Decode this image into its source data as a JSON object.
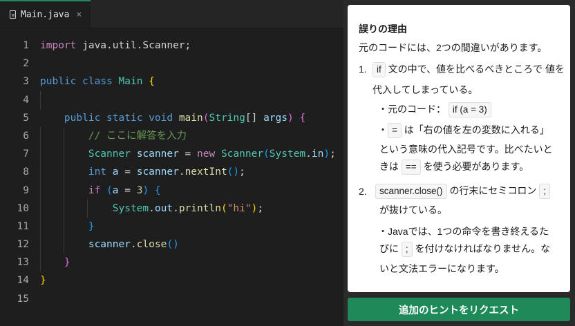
{
  "editor": {
    "tab": {
      "filename": "Main.java",
      "close": "×"
    },
    "line_numbers": [
      "1",
      "2",
      "3",
      "4",
      "5",
      "6",
      "7",
      "8",
      "9",
      "10",
      "11",
      "12",
      "13",
      "14",
      "15"
    ],
    "code": {
      "l1_import": "import",
      "l1_rest": " java.util.Scanner;",
      "l3_public": "public",
      "l3_class": "class",
      "l3_name": "Main",
      "l3_brace": "{",
      "l5_public": "public",
      "l5_static": "static",
      "l5_void": "void",
      "l5_main": "main",
      "l5_open": "(",
      "l5_type": "String",
      "l5_arr": "[]",
      "l5_args": "args",
      "l5_close": ")",
      "l5_brace": "{",
      "l6_comment": "// ここに解答を入力",
      "l7_type": "Scanner",
      "l7_var": "scanner",
      "l7_eq": " = ",
      "l7_new": "new",
      "l7_ctor": "Scanner",
      "l7_open": "(",
      "l7_sys": "System",
      "l7_dot": ".",
      "l7_in": "in",
      "l7_close": ")",
      "l7_semi": ";",
      "l8_int": "int",
      "l8_a": "a",
      "l8_eq": " = ",
      "l8_scanner": "scanner",
      "l8_dot": ".",
      "l8_next": "nextInt",
      "l8_parens": "()",
      "l8_semi": ";",
      "l9_if": "if",
      "l9_open": "(",
      "l9_a": "a",
      "l9_eq": " = ",
      "l9_num": "3",
      "l9_close": ")",
      "l9_brace": "{",
      "l10_sys": "System",
      "l10_dot1": ".",
      "l10_out": "out",
      "l10_dot2": ".",
      "l10_println": "println",
      "l10_open": "(",
      "l10_str": "\"hi\"",
      "l10_close": ")",
      "l10_semi": ";",
      "l11_brace": "}",
      "l12_scanner": "scanner",
      "l12_dot": ".",
      "l12_close_fn": "close",
      "l12_parens": "()",
      "l13_brace": "}",
      "l14_brace": "}"
    }
  },
  "panel": {
    "title": "誤りの理由",
    "intro": "元のコードには、2つの間違いがあります。",
    "item1": {
      "num": "1.",
      "chip": "if",
      "text_a": "文の中で、値を比べるべきところで 値を",
      "text_b": "代入してしまっている。",
      "sub1_label": "元のコード：",
      "sub1_chip": "if (a = 3)",
      "sub2_chip": "=",
      "sub2_text_a": "は「右の値を左の変数に入れる」",
      "sub2_text_b": "という意味の代入記号です。比べたいと",
      "sub2_text_c_pre": "きは",
      "sub2_chip2": "==",
      "sub2_text_c_post": "を使う必要があります。"
    },
    "item2": {
      "num": "2.",
      "chip": "scanner.close()",
      "text_a": "の行末にセミコロン",
      "chip2": ";",
      "text_b": "が抜けている。",
      "sub_text_a": "Javaでは、1つの命令を書き終えるた",
      "sub_text_b_pre": "びに",
      "sub_chip": ";",
      "sub_text_b_post": "を付けなければなりません。な",
      "sub_text_c": "いと文法エラーになります。"
    },
    "bullet": "・"
  },
  "hint_button": {
    "label": "追加のヒントをリクエスト"
  }
}
